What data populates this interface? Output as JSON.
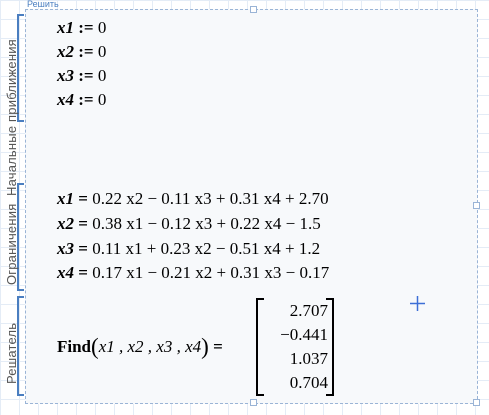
{
  "region": {
    "label": "Решить"
  },
  "sections": {
    "initial": {
      "label": "Начальные приближения"
    },
    "constraints": {
      "label": "Ограничения"
    },
    "solver": {
      "label": "Решатель"
    }
  },
  "initial_lines": [
    {
      "name": "x1",
      "op": ":=",
      "rest": "0"
    },
    {
      "name": "x2",
      "op": ":=",
      "rest": "0"
    },
    {
      "name": "x3",
      "op": ":=",
      "rest": "0"
    },
    {
      "name": "x4",
      "op": ":=",
      "rest": "0"
    }
  ],
  "constraint_lines": [
    {
      "name": "x1",
      "op": "=",
      "rest": "0.22 x2 − 0.11 x3 + 0.31 x4 + 2.70"
    },
    {
      "name": "x2",
      "op": "=",
      "rest": "0.38 x1 − 0.12 x3 + 0.22 x4 − 1.5"
    },
    {
      "name": "x3",
      "op": "=",
      "rest": "0.11 x1 + 0.23 x2 − 0.51 x4 + 1.2"
    },
    {
      "name": "x4",
      "op": "=",
      "rest": "0.17 x1 − 0.21 x2 + 0.31 x3 − 0.17"
    }
  ],
  "find": {
    "function": "Find",
    "args": "x1 , x2 , x3 , x4",
    "equals": "=",
    "results": [
      "2.707",
      "−0.441",
      "1.037",
      "0.704"
    ]
  }
}
